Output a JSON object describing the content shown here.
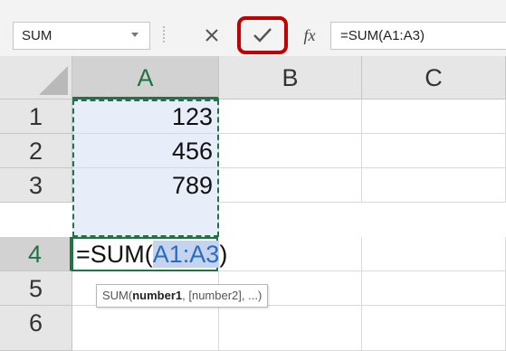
{
  "formula_bar": {
    "name_box": "SUM",
    "cancel_icon": "x-icon",
    "enter_icon": "checkmark-icon",
    "fx_label": "fx",
    "formula_text": "=SUM(A1:A3)"
  },
  "columns": [
    "A",
    "B",
    "C"
  ],
  "rows": [
    {
      "num": "1",
      "a": "123"
    },
    {
      "num": "2",
      "a": "456"
    },
    {
      "num": "3",
      "a": "789"
    },
    {
      "num": "4",
      "a": ""
    },
    {
      "num": "5",
      "a": ""
    },
    {
      "num": "6",
      "a": ""
    }
  ],
  "edit_cell": {
    "prefix": "=SUM(",
    "ref": "A1:A3",
    "suffix": ")"
  },
  "tooltip": {
    "func": "SUM(",
    "arg1": "number1",
    "rest": ", [number2], ...)"
  },
  "colors": {
    "accent_green": "#217346",
    "highlight_red": "#c00000",
    "ref_blue": "#2a6cc4"
  }
}
